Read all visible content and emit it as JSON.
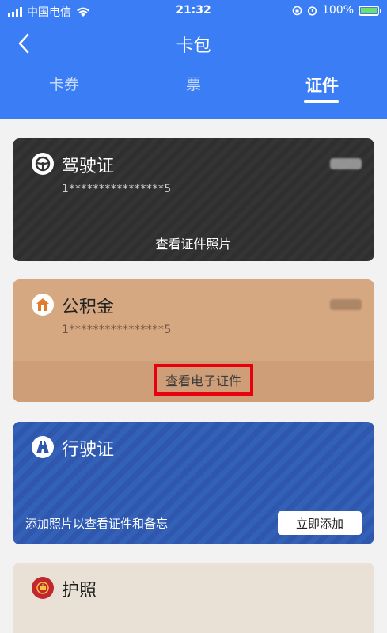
{
  "status_bar": {
    "carrier": "中国电信",
    "time": "21:32",
    "battery": "100%"
  },
  "nav": {
    "title": "卡包"
  },
  "tabs": [
    {
      "label": "卡券"
    },
    {
      "label": "票"
    },
    {
      "label": "证件"
    }
  ],
  "cards": {
    "driver_license": {
      "title": "驾驶证",
      "number": "1****************5",
      "action": "查看证件照片"
    },
    "housing_fund": {
      "title": "公积金",
      "number": "1****************5",
      "action": "查看电子证件"
    },
    "vehicle_license": {
      "title": "行驶证",
      "hint": "添加照片以查看证件和备忘",
      "button": "立即添加"
    },
    "passport": {
      "title": "护照"
    }
  },
  "colors": {
    "header_blue": "#3b7df4",
    "license_dark": "#2f2f2f",
    "fund_tan": "#d6a881",
    "vehicle_blue": "#2e57ad",
    "highlight_red": "#e8000e"
  }
}
